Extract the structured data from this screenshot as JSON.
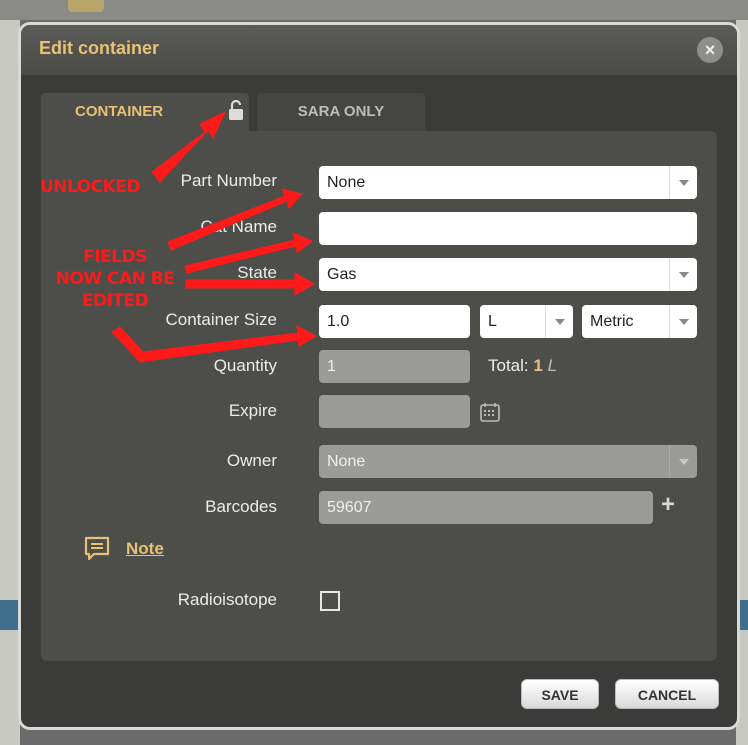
{
  "dialog": {
    "title": "Edit container"
  },
  "tabs": [
    {
      "label": "CONTAINER",
      "active": true
    },
    {
      "label": "SARA ONLY",
      "active": false
    }
  ],
  "form": {
    "part_number": {
      "label": "Part Number",
      "value": "None"
    },
    "cat_name": {
      "label": "Cat Name",
      "value": ""
    },
    "state": {
      "label": "State",
      "value": "Gas"
    },
    "container_size": {
      "label": "Container Size",
      "value": "1.0",
      "unit": "L",
      "system": "Metric"
    },
    "quantity": {
      "label": "Quantity",
      "value": "1",
      "total_label": "Total:",
      "total_value": "1",
      "total_unit": "L"
    },
    "expire": {
      "label": "Expire",
      "value": ""
    },
    "owner": {
      "label": "Owner",
      "value": "None"
    },
    "barcodes": {
      "label": "Barcodes",
      "value": "59607"
    },
    "note": {
      "label": "Note"
    },
    "radioisotope": {
      "label": "Radioisotope",
      "checked": false
    }
  },
  "buttons": {
    "save": "SAVE",
    "cancel": "CANCEL"
  },
  "annotations": {
    "unlocked": "UNLOCKED",
    "fields_line1": "FIELDS",
    "fields_line2": "NOW CAN BE",
    "fields_line3": "EDITED"
  },
  "colors": {
    "accent": "#e8c177",
    "annotation": "#ff1a1a",
    "panel": "#4d4d4a"
  }
}
